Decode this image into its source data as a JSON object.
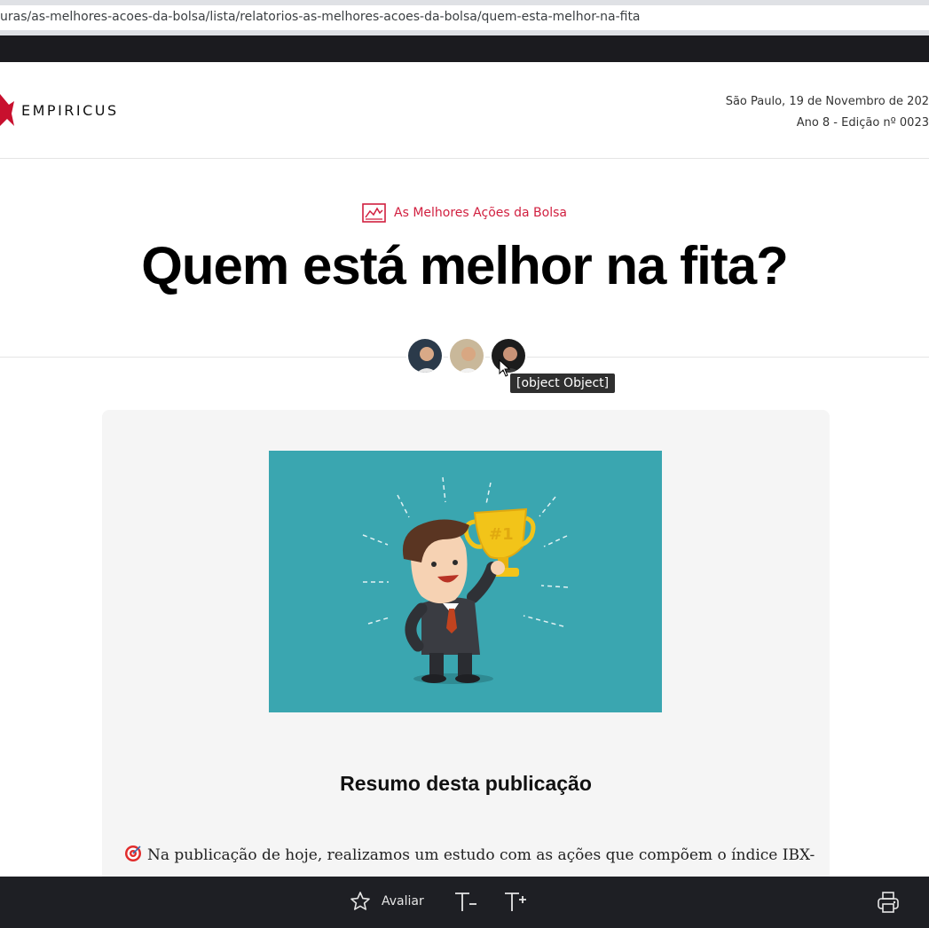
{
  "browser": {
    "url": "uras/as-melhores-acoes-da-bolsa/lista/relatorios-as-melhores-acoes-da-bolsa/quem-esta-melhor-na-fita"
  },
  "header": {
    "brand": "EMPIRICUS",
    "date_line": "São Paulo, 19 de Novembro de 202",
    "edition_line": "Ano 8 - Edição nº 0023"
  },
  "article": {
    "category": "As Melhores Ações da Bolsa",
    "title": "Quem está melhor na fita?",
    "tooltip": "[object Object]",
    "summary_heading": "Resumo desta publicação",
    "paragraph": "Na publicação de hoje, realizamos um estudo com as ações que compõem o índice IBX-"
  },
  "toolbar": {
    "rate_label": "Avaliar",
    "font_decrease_label": "T-",
    "font_increase_label": "T+"
  },
  "colors": {
    "accent": "#d11f3f",
    "hero_bg": "#3aa6b0",
    "toolbar_bg": "#1e1f24"
  }
}
